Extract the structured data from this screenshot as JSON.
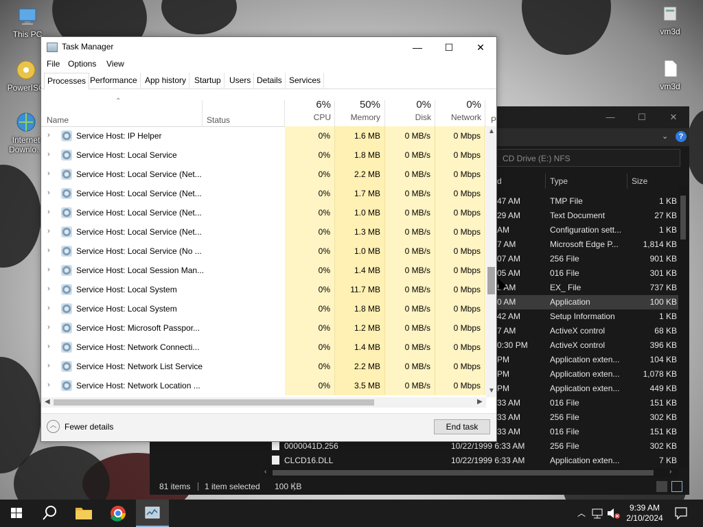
{
  "desktop": {
    "icons": [
      {
        "label": "This PC"
      },
      {
        "label": "PowerISO"
      },
      {
        "label": "Internet Downlo..."
      },
      {
        "label": "vm3d"
      },
      {
        "label": "vm3d"
      }
    ]
  },
  "task_manager": {
    "title": "Task Manager",
    "window_buttons": {
      "minimize": "—",
      "maximize": "☐",
      "close": "✕"
    },
    "menu": [
      "File",
      "Options",
      "View"
    ],
    "tabs": [
      "Processes",
      "Performance",
      "App history",
      "Startup",
      "Users",
      "Details",
      "Services"
    ],
    "active_tab": "Processes",
    "columns": {
      "name": "Name",
      "status": "Status",
      "cpu": {
        "pct": "6%",
        "label": "CPU"
      },
      "memory": {
        "pct": "50%",
        "label": "Memory"
      },
      "disk": {
        "pct": "0%",
        "label": "Disk"
      },
      "network": {
        "pct": "0%",
        "label": "Network"
      },
      "power": "P"
    },
    "processes": [
      {
        "name": "Service Host: IP Helper",
        "cpu": "0%",
        "memory": "1.6 MB",
        "disk": "0 MB/s",
        "network": "0 Mbps"
      },
      {
        "name": "Service Host: Local Service",
        "cpu": "0%",
        "memory": "1.8 MB",
        "disk": "0 MB/s",
        "network": "0 Mbps"
      },
      {
        "name": "Service Host: Local Service (Net...",
        "cpu": "0%",
        "memory": "2.2 MB",
        "disk": "0 MB/s",
        "network": "0 Mbps"
      },
      {
        "name": "Service Host: Local Service (Net...",
        "cpu": "0%",
        "memory": "1.7 MB",
        "disk": "0 MB/s",
        "network": "0 Mbps"
      },
      {
        "name": "Service Host: Local Service (Net...",
        "cpu": "0%",
        "memory": "1.0 MB",
        "disk": "0 MB/s",
        "network": "0 Mbps"
      },
      {
        "name": "Service Host: Local Service (Net...",
        "cpu": "0%",
        "memory": "1.3 MB",
        "disk": "0 MB/s",
        "network": "0 Mbps"
      },
      {
        "name": "Service Host: Local Service (No ...",
        "cpu": "0%",
        "memory": "1.0 MB",
        "disk": "0 MB/s",
        "network": "0 Mbps"
      },
      {
        "name": "Service Host: Local Session Man...",
        "cpu": "0%",
        "memory": "1.4 MB",
        "disk": "0 MB/s",
        "network": "0 Mbps"
      },
      {
        "name": "Service Host: Local System",
        "cpu": "0%",
        "memory": "11.7 MB",
        "disk": "0 MB/s",
        "network": "0 Mbps"
      },
      {
        "name": "Service Host: Local System",
        "cpu": "0%",
        "memory": "1.8 MB",
        "disk": "0 MB/s",
        "network": "0 Mbps"
      },
      {
        "name": "Service Host: Microsoft Passpor...",
        "cpu": "0%",
        "memory": "1.2 MB",
        "disk": "0 MB/s",
        "network": "0 Mbps"
      },
      {
        "name": "Service Host: Network Connecti...",
        "cpu": "0%",
        "memory": "1.4 MB",
        "disk": "0 MB/s",
        "network": "0 Mbps"
      },
      {
        "name": "Service Host: Network List Service",
        "cpu": "0%",
        "memory": "2.2 MB",
        "disk": "0 MB/s",
        "network": "0 Mbps"
      },
      {
        "name": "Service Host: Network Location ...",
        "cpu": "0%",
        "memory": "3.5 MB",
        "disk": "0 MB/s",
        "network": "0 Mbps"
      }
    ],
    "footer": {
      "fewer_details": "Fewer details",
      "end_task": "End task"
    }
  },
  "explorer": {
    "address": "CD Drive (E:) NFS",
    "columns": {
      "date": "d",
      "type": "Type",
      "size": "Size"
    },
    "files": [
      {
        "name": "",
        "date": "47 AM",
        "type": "TMP File",
        "size": "1 KB"
      },
      {
        "name": "",
        "date": "29 AM",
        "type": "Text Document",
        "size": "27 KB"
      },
      {
        "name": "",
        "date": "AM",
        "type": "Configuration sett...",
        "size": "1 KB"
      },
      {
        "name": "",
        "date": "7 AM",
        "type": "Microsoft Edge P...",
        "size": "1,814 KB"
      },
      {
        "name": "",
        "date": "07 AM",
        "type": "256 File",
        "size": "901 KB"
      },
      {
        "name": "",
        "date": "05 AM",
        "type": "016 File",
        "size": "301 KB"
      },
      {
        "name": "",
        "date": "5 AM",
        "type": "EX_ File",
        "size": "737 KB"
      },
      {
        "name": "",
        "date": "0 AM",
        "type": "Application",
        "size": "100 KB"
      },
      {
        "name": "",
        "date": "42 AM",
        "type": "Setup Information",
        "size": "1 KB"
      },
      {
        "name": "",
        "date": "7 AM",
        "type": "ActiveX control",
        "size": "68 KB"
      },
      {
        "name": "",
        "date": "0:30 PM",
        "type": "ActiveX control",
        "size": "396 KB"
      },
      {
        "name": "",
        "date": "PM",
        "type": "Application exten...",
        "size": "104 KB"
      },
      {
        "name": "",
        "date": "PM",
        "type": "Application exten...",
        "size": "1,078 KB"
      },
      {
        "name": "",
        "date": "PM",
        "type": "Application exten...",
        "size": "449 KB"
      },
      {
        "name": "",
        "date": "33 AM",
        "type": "016 File",
        "size": "151 KB"
      },
      {
        "name": "",
        "date": "33 AM",
        "type": "256 File",
        "size": "302 KB"
      },
      {
        "name": "",
        "date": "33 AM",
        "type": "016 File",
        "size": "151 KB"
      },
      {
        "name": "0000041D.256",
        "date": "10/22/1999 6:33 AM",
        "type": "256 File",
        "size": "302 KB"
      },
      {
        "name": "CLCD16.DLL",
        "date": "10/22/1999 6:33 AM",
        "type": "Application exten...",
        "size": "7 KB"
      }
    ],
    "status": {
      "items": "81 items",
      "selected": "1 item selected",
      "size": "100 KB"
    }
  },
  "taskbar": {
    "time": "9:39 AM",
    "date": "2/10/2024"
  }
}
